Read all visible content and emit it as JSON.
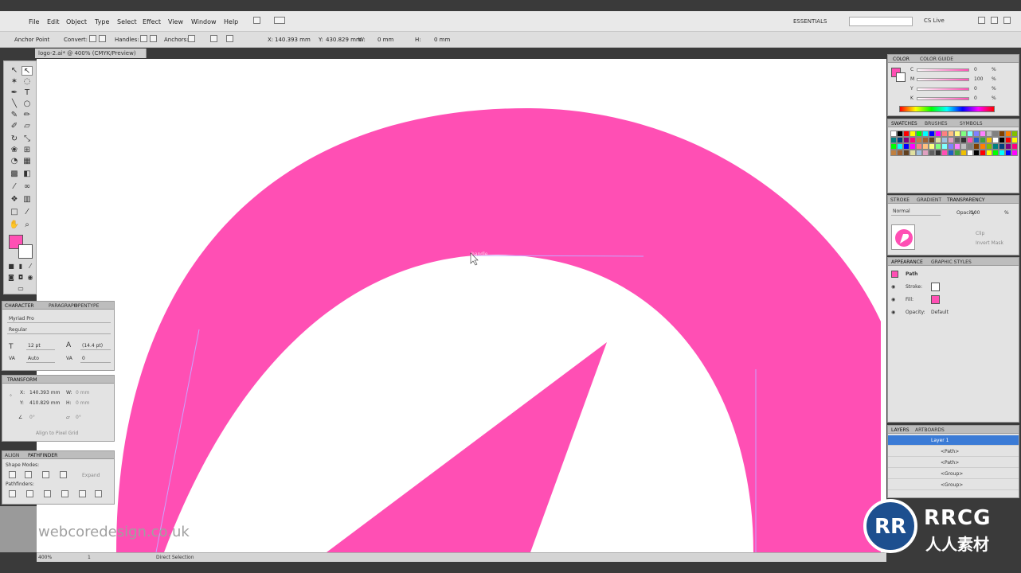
{
  "menu": [
    "File",
    "Edit",
    "Object",
    "Type",
    "Select",
    "Effect",
    "View",
    "Window",
    "Help"
  ],
  "workspace": "ESSENTIALS",
  "cslive": "CS Live",
  "control": {
    "mode": "Anchor Point",
    "convert": "Convert:",
    "handles": "Handles:",
    "anchors": "Anchors:",
    "x_label": "X:",
    "x_value": "140.393 mm",
    "y_label": "Y:",
    "y_value": "430.829 mm",
    "w_label": "W:",
    "w_value": "0 mm",
    "h_label": "H:",
    "h_value": "0 mm"
  },
  "doc_tab": "logo-2.ai* @ 400% (CMYK/Preview)",
  "character": {
    "tabs": [
      "CHARACTER",
      "PARAGRAPH",
      "OPENTYPE"
    ],
    "font": "Myriad Pro",
    "style": "Regular",
    "size": "12 pt",
    "leading": "(14.4 pt)",
    "kerning": "Auto",
    "tracking": "0"
  },
  "transform": {
    "title": "TRANSFORM",
    "x_label": "X:",
    "x_value": "140.393 mm",
    "y_label": "Y:",
    "y_value": "410.829 mm",
    "w_label": "W:",
    "w_value": "0 mm",
    "h_label": "H:",
    "h_value": "0 mm",
    "angle1": "0°",
    "angle2": "0°",
    "align_pixel": "Align to Pixel Grid"
  },
  "pathfinder": {
    "tabs": [
      "ALIGN",
      "PATHFINDER"
    ],
    "shape_modes": "Shape Modes:",
    "pathfinders": "Pathfinders:",
    "expand": "Expand"
  },
  "color_panel": {
    "tabs": [
      "COLOR",
      "COLOR GUIDE"
    ],
    "c_label": "C",
    "c_value": "0",
    "m_label": "M",
    "m_value": "100",
    "y_label": "Y",
    "y_value": "0",
    "k_label": "K",
    "k_value": "0",
    "pct": "%"
  },
  "swatch_panel": {
    "tabs": [
      "SWATCHES",
      "BRUSHES",
      "SYMBOLS"
    ]
  },
  "transparency": {
    "tabs": [
      "STROKE",
      "GRADIENT",
      "TRANSPARENCY"
    ],
    "blend": "Normal",
    "opacity_label": "Opacity:",
    "opacity_value": "100",
    "pct": "%",
    "clip": "Clip",
    "invert": "Invert Mask"
  },
  "appearance": {
    "tabs": [
      "APPEARANCE",
      "GRAPHIC STYLES"
    ],
    "title": "Path",
    "stroke": "Stroke:",
    "fill": "Fill:",
    "opacity_label": "Opacity:",
    "opacity_value": "Default"
  },
  "layers": {
    "tabs": [
      "LAYERS",
      "ARTBOARDS"
    ],
    "rows": [
      "Layer 1",
      "<Path>",
      "<Path>",
      "<Group>",
      "<Group>"
    ]
  },
  "status": {
    "zoom": "400%",
    "page": "1",
    "tool": "Direct Selection"
  },
  "canvas_watermark": "webcoredesign.co.uk",
  "handle_label": "handle",
  "logo": {
    "text": "RRCG",
    "sub": "人人素材"
  },
  "colors": {
    "pink": "#ff4fb4",
    "ui": "#e3e3e3"
  }
}
